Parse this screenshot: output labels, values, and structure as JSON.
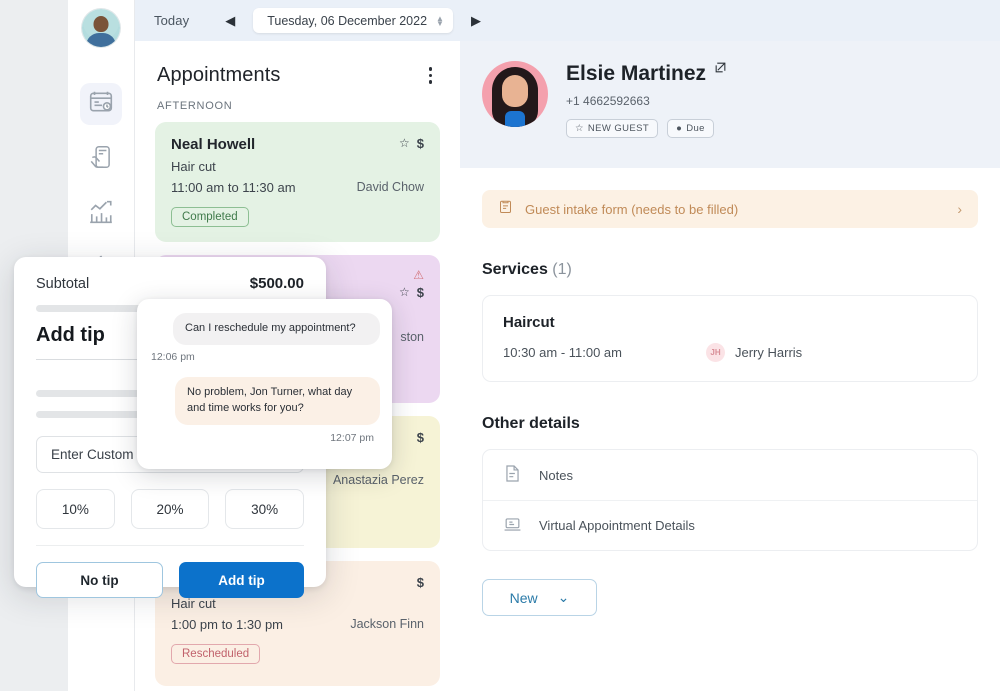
{
  "topbar": {
    "today_label": "Today",
    "prev_icon": "triangle-left-icon",
    "next_icon": "triangle-right-icon",
    "date_value": "Tuesday, 06 December 2022"
  },
  "rail": {
    "avatar_name": "user-avatar",
    "items": [
      {
        "icon": "appointments-calendar-icon",
        "active": true
      },
      {
        "icon": "payment-card-hand-icon",
        "active": false
      },
      {
        "icon": "analytics-bar-chart-icon",
        "active": false
      },
      {
        "icon": "settings-gear-icon",
        "active": false
      }
    ]
  },
  "appointments": {
    "title": "Appointments",
    "menu_icon": "kebab-menu-icon",
    "daypart": "AFTERNOON",
    "cards": [
      {
        "color": "green",
        "name": "Neal Howell",
        "service": "Hair cut",
        "time": "11:00 am to 11:30 am",
        "staff": "David Chow",
        "status": "Completed",
        "status_kind": "completed",
        "warning": false,
        "star": true,
        "dollar": "$"
      },
      {
        "color": "purple",
        "name": "",
        "service": "",
        "time": "",
        "staff": "ston",
        "status": "",
        "status_kind": "",
        "warning": true,
        "star": true,
        "dollar": "$"
      },
      {
        "color": "yellow",
        "name": "",
        "service": "",
        "time": "",
        "staff": "Anastazia Perez",
        "status": "",
        "status_kind": "",
        "warning": false,
        "star": false,
        "dollar": "$"
      },
      {
        "color": "peach",
        "name": "",
        "service": "Hair cut",
        "time": "1:00 pm to 1:30 pm",
        "staff": "Jackson Finn",
        "status": "Rescheduled",
        "status_kind": "rescheduled",
        "warning": false,
        "star": false,
        "dollar": "$"
      }
    ]
  },
  "detail": {
    "client_name": "Elsie Martinez",
    "open_icon": "external-link-icon",
    "phone": "+1 4662592663",
    "badges": [
      {
        "icon": "star-icon",
        "label": "NEW GUEST"
      },
      {
        "icon": "dollar-circle-icon",
        "label": "Due"
      }
    ],
    "intake": {
      "icon": "clipboard-form-icon",
      "text": "Guest intake form (needs to be filled)",
      "chevron": "chevron-right-icon"
    },
    "services_title": "Services",
    "services_count": "(1)",
    "services": [
      {
        "name": "Haircut",
        "time": "10:30 am - 11:00 am",
        "staff_initials": "JH",
        "staff": "Jerry Harris"
      }
    ],
    "other_title": "Other details",
    "other_rows": [
      {
        "icon": "notes-document-icon",
        "label": "Notes"
      },
      {
        "icon": "virtual-laptop-icon",
        "label": "Virtual Appointment Details"
      }
    ],
    "new_button": {
      "label": "New",
      "chevron": "chevron-down-icon"
    }
  },
  "chat": {
    "messages": [
      {
        "side": "incoming",
        "text": "Can I reschedule my appointment?",
        "time": "12:06 pm"
      },
      {
        "side": "outgoing",
        "text": "No problem, Jon Turner, what day and time works for you?",
        "time": "12:07 pm"
      }
    ]
  },
  "tip_modal": {
    "subtotal_label": "Subtotal",
    "subtotal_amount": "$500.00",
    "title": "Add tip",
    "custom_placeholder": "Enter Custom",
    "percents": [
      "10%",
      "20%",
      "30%"
    ],
    "no_tip_label": "No tip",
    "add_tip_label": "Add tip"
  },
  "colors": {
    "primary": "#0c72cb",
    "topbar_bg": "#eaf0f8",
    "hero_bg": "#eef2f8",
    "card_green": "#e4f2e4",
    "card_purple": "#ecd8f1",
    "card_yellow": "#f6f3d6",
    "card_peach": "#fbefe4",
    "intake": "#fcf1e4"
  }
}
